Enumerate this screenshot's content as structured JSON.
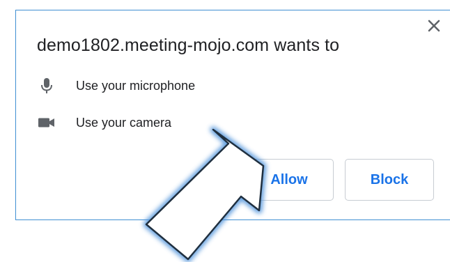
{
  "dialog": {
    "title": "demo1802.meeting-mojo.com wants to",
    "close_icon": "close-icon",
    "permissions": [
      {
        "icon": "microphone-icon",
        "label": "Use your microphone"
      },
      {
        "icon": "camera-icon",
        "label": "Use your camera"
      }
    ],
    "buttons": {
      "allow_label": "Allow",
      "block_label": "Block"
    }
  },
  "annotation": {
    "icon": "callout-arrow",
    "fill_color": "#ffffff",
    "stroke_color": "#1f2f3f",
    "glow_color": "#4a8fd9"
  },
  "colors": {
    "accent": "#1a73e8",
    "dialog_border": "#3f8fd3",
    "text": "#202124",
    "icon": "#5f6368"
  }
}
